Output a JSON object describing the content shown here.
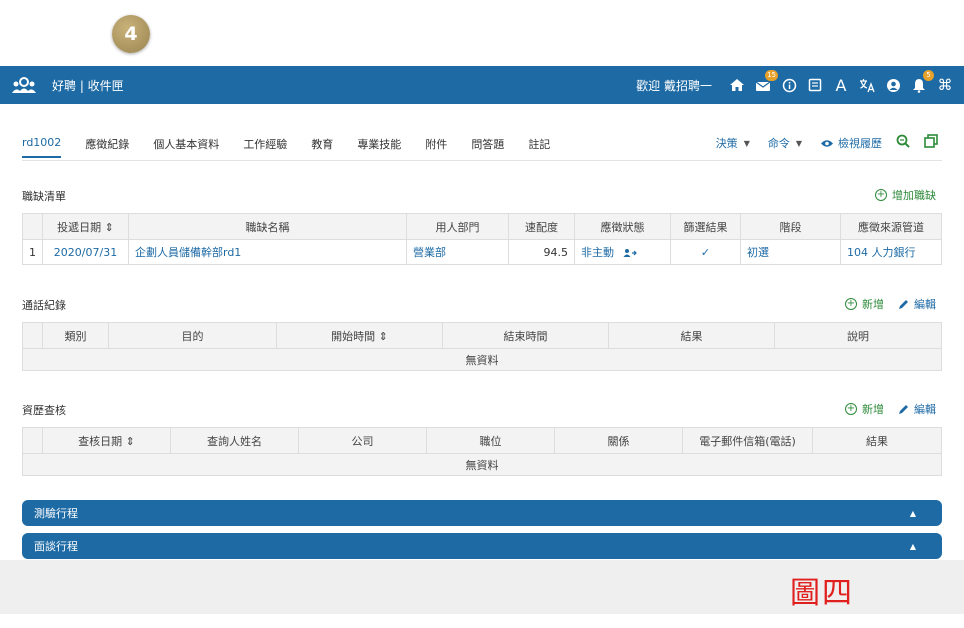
{
  "step": "4",
  "header": {
    "app_title": "好聘 | 收件匣",
    "welcome": "歡迎 戴招聘一",
    "icons": [
      {
        "name": "home-icon",
        "glyph": "⌂",
        "badge": ""
      },
      {
        "name": "inbox-icon",
        "glyph": "▭",
        "badge": "15"
      },
      {
        "name": "info-icon",
        "glyph": "ⓘ",
        "badge": ""
      },
      {
        "name": "notes-icon",
        "glyph": "▤",
        "badge": ""
      },
      {
        "name": "font-size-icon",
        "glyph": "A",
        "badge": ""
      },
      {
        "name": "translate-icon",
        "glyph": "文",
        "badge": ""
      },
      {
        "name": "user-icon",
        "glyph": "●",
        "badge": ""
      },
      {
        "name": "notification-bell-icon",
        "glyph": "▲",
        "badge": "5"
      },
      {
        "name": "command-icon",
        "glyph": "⌘",
        "badge": ""
      }
    ]
  },
  "tabs": [
    "rd1002",
    "應徵紀錄",
    "個人基本資料",
    "工作經驗",
    "教育",
    "專業技能",
    "附件",
    "問答題",
    "註記"
  ],
  "tabs_right": {
    "decision": "決策",
    "command": "命令",
    "view_history": "檢視履歷"
  },
  "jobs": {
    "title": "職缺清單",
    "add_label": "增加職缺",
    "columns": [
      "",
      "投遞日期 ⇕",
      "職缺名稱",
      "用人部門",
      "速配度",
      "應徵狀態",
      "篩選結果",
      "階段",
      "應徵來源管道"
    ],
    "rows": [
      {
        "idx": "1",
        "date": "2020/07/31",
        "name": "企劃人員儲備幹部rd1",
        "dept": "營業部",
        "match": "94.5",
        "status": "非主動",
        "screen": "✓",
        "stage": "初選",
        "source": "104 人力銀行"
      }
    ]
  },
  "calls": {
    "title": "通話紀錄",
    "add_label": "新增",
    "edit_label": "編輯",
    "columns": [
      "",
      "類別",
      "目的",
      "開始時間 ⇕",
      "結束時間",
      "結果",
      "說明"
    ],
    "empty": "無資料"
  },
  "refs": {
    "title": "資歷查核",
    "add_label": "新增",
    "edit_label": "編輯",
    "columns": [
      "",
      "查核日期 ⇕",
      "查詢人姓名",
      "公司",
      "職位",
      "關係",
      "電子郵件信箱(電話)",
      "結果"
    ],
    "empty": "無資料"
  },
  "accordions": [
    "測驗行程",
    "面談行程"
  ],
  "figure_label": "圖四",
  "colors": {
    "primary": "#1d6aa5",
    "green": "#2e8a3a",
    "badge": "#e5a129",
    "figure": "#e0201e"
  }
}
